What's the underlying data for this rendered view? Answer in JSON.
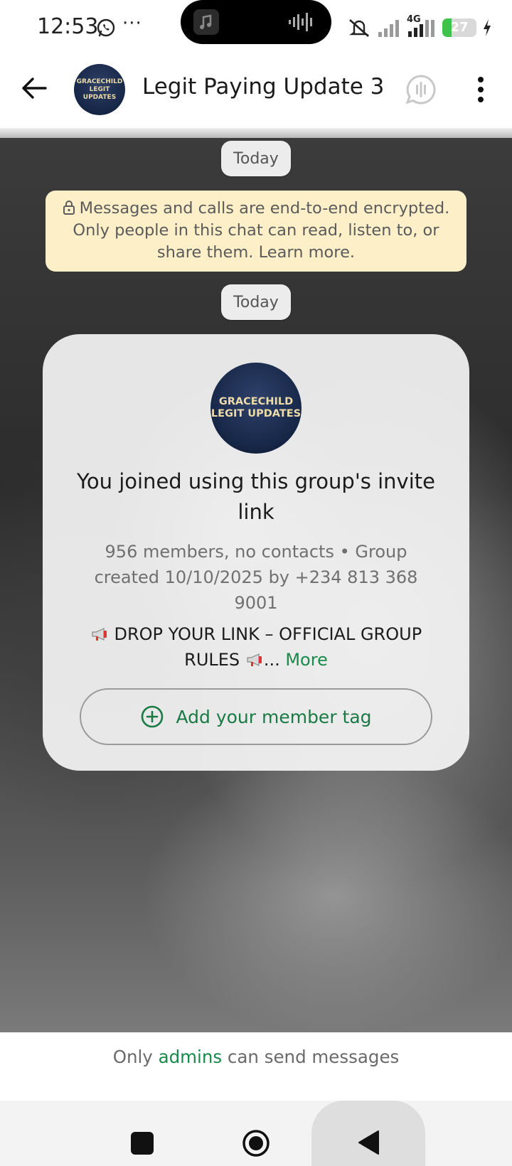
{
  "status_bar": {
    "time": "12:53",
    "overflow": "···",
    "network": "4G",
    "battery": "27",
    "battery_level_percent": 27,
    "icons": [
      "whatsapp-icon",
      "music-icon",
      "audio-wave-icon",
      "mute-icon",
      "signal-icon",
      "charging-icon"
    ]
  },
  "header": {
    "title": "Legit Paying Update 3",
    "avatar_text": "GRACECHILD\nLEGIT UPDATES"
  },
  "chat": {
    "date_labels": [
      "Today",
      "Today"
    ],
    "encryption_notice": "Messages and calls are end-to-end encrypted. Only people in this chat can read, listen to, or share them. Learn more."
  },
  "group_card": {
    "avatar_text": "GRACECHILD\nLEGIT UPDATES",
    "title": "You joined using this group's invite link",
    "meta": "956 members, no contacts  •  Group created 10/10/2025 by +234 813 368 9001",
    "description": "DROP YOUR LINK – OFFICIAL GROUP RULES",
    "ellipsis": "...",
    "more_label": "More",
    "member_tag_label": "Add your member tag"
  },
  "footer": {
    "prefix": "Only ",
    "link": "admins",
    "suffix": " can send messages"
  },
  "colors": {
    "accent_green": "#1a8a4c",
    "encryption_bg": "#fdefc8",
    "battery_green": "#3ec24b"
  }
}
